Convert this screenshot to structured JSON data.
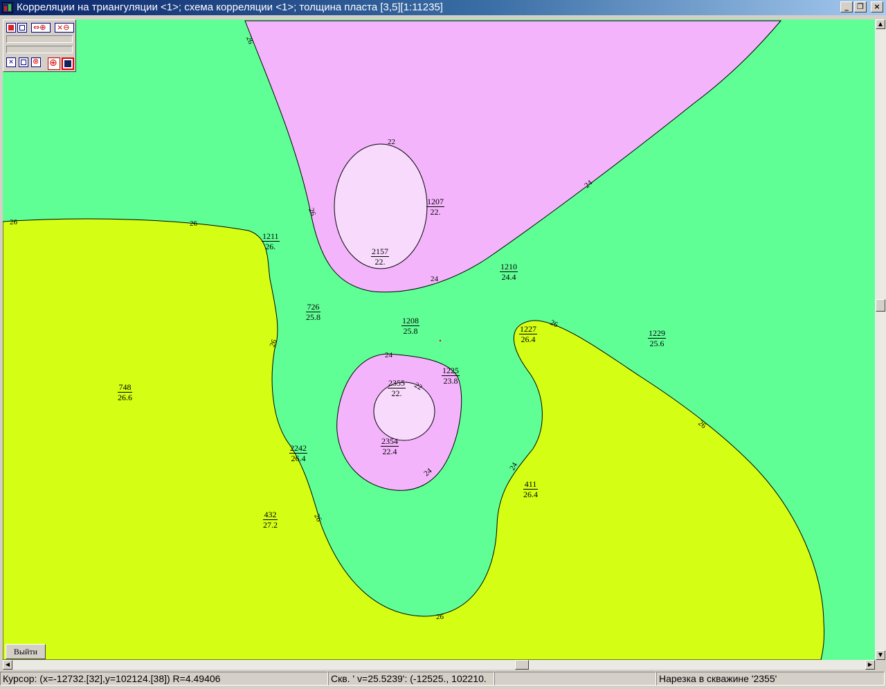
{
  "window": {
    "title": "Корреляции на триангуляции <1>; схема корреляции <1>; толщина пласта [3,5][1:11235]",
    "minimize_glyph": "_",
    "restore_glyph": "❐",
    "close_glyph": "×"
  },
  "colors": {
    "zone_green": "#60ff96",
    "zone_yellow": "#d4ff14",
    "zone_pink": "#f4b4fc",
    "zone_light_pink": "#f8dafc",
    "title_start": "#0a246a",
    "title_end": "#a6caf0"
  },
  "contour_labels": [
    "26",
    "26",
    "26",
    "26",
    "26",
    "26",
    "26",
    "26",
    "26",
    "24",
    "24",
    "24",
    "24",
    "24",
    "22",
    "22"
  ],
  "wells": [
    {
      "number": "1207",
      "value": "22."
    },
    {
      "number": "2157",
      "value": "22."
    },
    {
      "number": "1211",
      "value": "26."
    },
    {
      "number": "1210",
      "value": "24.4"
    },
    {
      "number": "726",
      "value": "25.8"
    },
    {
      "number": "1208",
      "value": "25.8"
    },
    {
      "number": "1227",
      "value": "26.4"
    },
    {
      "number": "1229",
      "value": "25.6"
    },
    {
      "number": "1225",
      "value": "23.8"
    },
    {
      "number": "2355",
      "value": "22."
    },
    {
      "number": "748",
      "value": "26.6"
    },
    {
      "number": "2354",
      "value": "22.4"
    },
    {
      "number": "2242",
      "value": "26.4"
    },
    {
      "number": "411",
      "value": "26.4"
    },
    {
      "number": "432",
      "value": "27.2"
    }
  ],
  "toolbar": {
    "buttons": [
      "hatch-toggle",
      "frame",
      "pan-zoom-in",
      "zoom-out-x",
      "zoom-out",
      "close-x",
      "list",
      "no-entry",
      "target",
      "screen"
    ]
  },
  "exit_button": {
    "label": "Выйти"
  },
  "status": {
    "cursor": "Курсор: (x=-12732.[32],y=102124.[38]) R=4.49406",
    "well": "Скв. ' v=25.5239': (-12525., 102210.",
    "empty": "",
    "cutting": "Нарезка в скважине '2355'"
  }
}
